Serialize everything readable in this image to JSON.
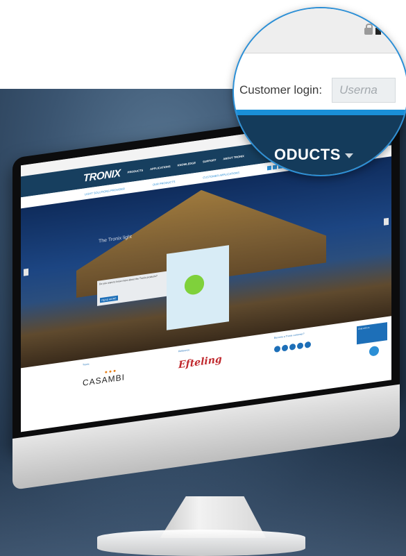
{
  "magnifier": {
    "login_label": "Customer login:",
    "username_placeholder": "Userna",
    "nav_products": "ODUCTS"
  },
  "website": {
    "logo": "TRONIX",
    "tagline": "LIGHT SOLUTIONS PROVIDER",
    "nav": [
      "PRODUCTS",
      "APPLICATIONS",
      "KNOWLEDGE",
      "SUPPORT",
      "ABOUT TRONIX"
    ],
    "sub_links": [
      "OUR PRODUCTS",
      "CUSTOMER APPLICATIONS"
    ],
    "hero_title": "The Tronix light",
    "callout_text": "Do you want to know more about the Tronix products?",
    "callout_button": "READ MORE",
    "partners": [
      {
        "head": "Tronix",
        "name": "CASAMBI"
      },
      {
        "head": "Reference",
        "name": "Efteling"
      },
      {
        "head": "Become a Tronix customer?",
        "name": ""
      }
    ],
    "chat_text": "Chat with us"
  },
  "colors": {
    "navy": "#143b5b",
    "accent_blue": "#1a8fd8"
  }
}
